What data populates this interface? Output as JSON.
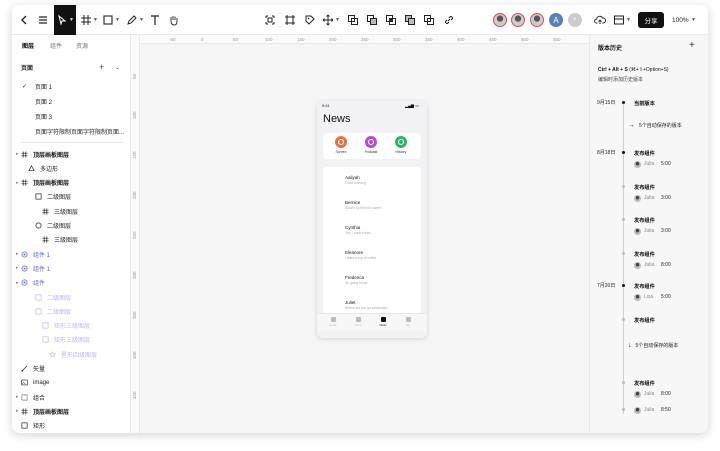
{
  "toolbar": {
    "share_label": "分享",
    "zoom_label": "100%"
  },
  "left_panel": {
    "tabs": [
      "图层",
      "组件",
      "资源"
    ],
    "pages_header": "页面",
    "pages": [
      "页面 1",
      "页面 2",
      "页面 3",
      "页面字符限制页面字符限制页面..."
    ],
    "layers": [
      {
        "label": "顶层画板图层",
        "icon": "frame-icon",
        "style": "bold"
      },
      {
        "label": "多边形",
        "icon": "polygon-icon",
        "style": "normal"
      },
      {
        "label": "顶层画板图层",
        "icon": "frame-icon",
        "style": "bold"
      },
      {
        "label": "二级图层",
        "icon": "square-icon",
        "style": "normal"
      },
      {
        "label": "三级图层",
        "icon": "frame-icon",
        "style": "normal"
      },
      {
        "label": "二级图层",
        "icon": "circle-icon",
        "style": "normal"
      },
      {
        "label": "三级图层",
        "icon": "frame-icon",
        "style": "normal"
      },
      {
        "label": "组件 1",
        "icon": "component-icon",
        "style": "purple"
      },
      {
        "label": "组件 1",
        "icon": "component-icon",
        "style": "purple"
      },
      {
        "label": "组件",
        "icon": "component-icon",
        "style": "purple"
      },
      {
        "label": "二级图层",
        "icon": "square-icon",
        "style": "lilac"
      },
      {
        "label": "二级图层",
        "icon": "square-icon",
        "style": "lilac"
      },
      {
        "label": "矩形三级图层",
        "icon": "square-icon",
        "style": "lilac"
      },
      {
        "label": "矩形三级图层",
        "icon": "square-icon",
        "style": "lilac"
      },
      {
        "label": "星形四级图层",
        "icon": "star-icon",
        "style": "lilac"
      },
      {
        "label": "矢量",
        "icon": "vector-icon",
        "style": "normal"
      },
      {
        "label": "image",
        "icon": "image-icon",
        "style": "normal"
      },
      {
        "label": "组合",
        "icon": "group-icon",
        "style": "normal"
      },
      {
        "label": "顶层画板图层",
        "icon": "frame-icon",
        "style": "bold"
      },
      {
        "label": "矩形",
        "icon": "square-icon",
        "style": "normal"
      }
    ]
  },
  "canvas": {
    "ruler_x": [
      "-50",
      "0",
      "50",
      "100",
      "150",
      "200",
      "250",
      "300",
      "350",
      "400",
      "450",
      "500",
      "550"
    ],
    "ruler_y": [
      "50",
      "100",
      "150",
      "200",
      "250",
      "300",
      "350",
      "400",
      "450"
    ],
    "phone": {
      "time": "9:41",
      "title": "News",
      "favorites": [
        {
          "label": "Screen",
          "color": "#e8743b"
        },
        {
          "label": "Podcast",
          "color": "#b04fd6"
        },
        {
          "label": "History",
          "color": "#2fb36a"
        }
      ],
      "contacts": [
        {
          "name": "Aaliyah",
          "msg": "Good morning"
        },
        {
          "name": "Bernice",
          "msg": "What's up friend's name?"
        },
        {
          "name": "Cynthia",
          "msg": "Yes, I think it was"
        },
        {
          "name": "Eleanore",
          "msg": "I want a cup of coffee"
        },
        {
          "name": "Frederica",
          "msg": "I'm going home"
        },
        {
          "name": "Juliet",
          "msg": "Where did you go yesterday?"
        }
      ],
      "tabs": [
        "Home",
        "Inbox",
        "News",
        "Me"
      ],
      "active_tab": "News"
    }
  },
  "history": {
    "title": "版本历史",
    "shortcut": "Ctrl + Alt + S",
    "shortcut_mac": "(⌘+⇧+Option+S)",
    "description": "编辑时添加历史版本",
    "entries": [
      {
        "date": "9月15日",
        "type": "current",
        "label": "当前版本"
      },
      {
        "type": "auto",
        "label": "5个自动保存的版本"
      },
      {
        "date": "8月18日",
        "type": "event",
        "label": "发布组件",
        "user": "Julia",
        "time": "5:00"
      },
      {
        "type": "event",
        "label": "发布组件",
        "user": "Julia",
        "time": "3:00"
      },
      {
        "type": "event",
        "label": "发布组件",
        "user": "Julia",
        "time": "3:00"
      },
      {
        "type": "event",
        "label": "发布组件",
        "user": "Julia",
        "time": "8:00"
      },
      {
        "date": "7月20日",
        "type": "event",
        "label": "发布组件",
        "user": "Lisa",
        "time": "5:00"
      },
      {
        "type": "event",
        "label": "发布组件"
      },
      {
        "type": "auto",
        "label": "5个自动保存的版本"
      },
      {
        "type": "event",
        "label": "发布组件",
        "user": "Julia",
        "time": "8:00"
      },
      {
        "type": "event",
        "user": "Julia",
        "time": "8:50"
      }
    ]
  }
}
